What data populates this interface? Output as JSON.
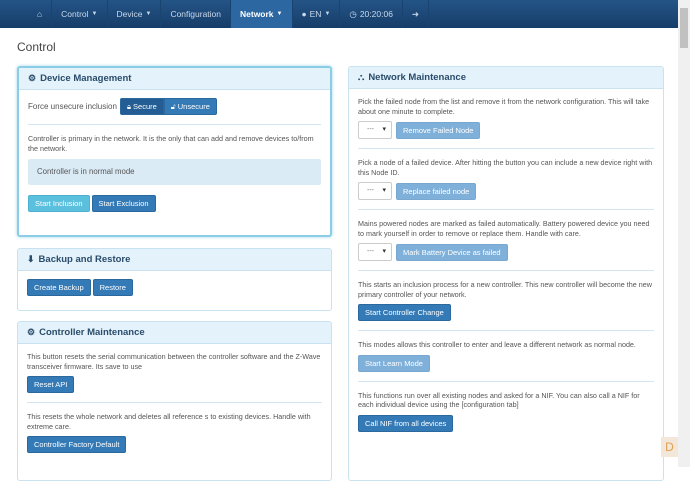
{
  "nav": {
    "items": [
      {
        "label": "Control"
      },
      {
        "label": "Device"
      },
      {
        "label": "Configuration"
      },
      {
        "label": "Network"
      },
      {
        "label": "EN"
      },
      {
        "label": "20:20:06"
      }
    ]
  },
  "page": {
    "title": "Control"
  },
  "device_management": {
    "title": "Device Management",
    "force_label": "Force unsecure inclusion",
    "secure": "Secure",
    "unsecure": "Unsecure",
    "info": "Controller is primary in the network. It is the only that can add and remove devices to/from the network.",
    "status": "Controller is in normal mode",
    "start_inclusion": "Start Inclusion",
    "start_exclusion": "Start Exclusion"
  },
  "backup": {
    "title": "Backup and Restore",
    "create": "Create Backup",
    "restore": "Restore"
  },
  "controller_maintenance": {
    "title": "Controller Maintenance",
    "reset_text": "This button resets the serial communication between the controller software and the Z-Wave transceiver firmware. Its save to use",
    "reset_api": "Reset API",
    "factory_text": "This resets the whole network and deletes all reference s to existing devices. Handle with extreme care.",
    "factory": "Controller Factory Default"
  },
  "network_maintenance": {
    "title": "Network Maintenance",
    "select_value": "---",
    "remove_text": "Pick the failed node from the list and remove it from the network configuration. This will take about one minute to complete.",
    "remove": "Remove Failed Node",
    "replace_text": "Pick a node of a failed device. After hitting the button you can include a new device right with this Node ID.",
    "replace": "Replace failed node",
    "mark_text": "Mains powered nodes are marked as failed automatically. Battery powered device you need to mark yourself in order to remove or replace them. Handle with care.",
    "mark": "Mark Battery Device as failed",
    "change_text": "This starts an inclusion process for a new controller. This new controller will become the new primary controller of your network.",
    "change": "Start Controller Change",
    "learn_text": "This modes allows this controller to enter and leave a different network as normal node.",
    "learn": "Start Learn Mode",
    "nif_text": "This functions run over all existing nodes and asked for a NIF. You can also call a NIF for each individual device using the [configuration tab]",
    "nif": "Call NIF from all devices"
  }
}
